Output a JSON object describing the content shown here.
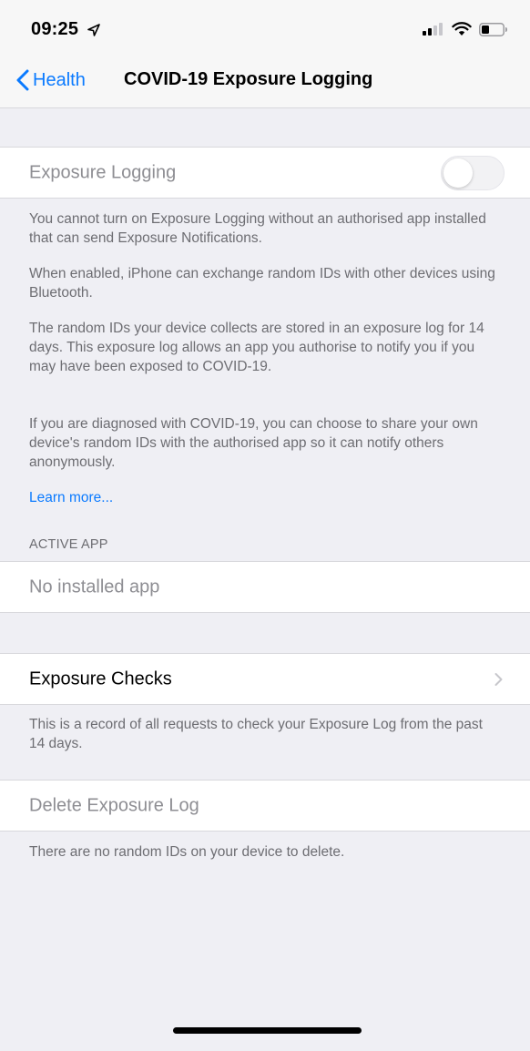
{
  "status_bar": {
    "time": "09:25",
    "icons": [
      "location-arrow-icon",
      "signal-icon",
      "wifi-icon",
      "battery-icon"
    ]
  },
  "nav": {
    "back_label": "Health",
    "title": "COVID-19 Exposure Logging"
  },
  "exposure_logging": {
    "label": "Exposure Logging",
    "toggle_on": false,
    "paragraphs": [
      "You cannot turn on Exposure Logging without an authorised app installed that can send Exposure Notifications.",
      "When enabled, iPhone can exchange random IDs with other devices using Bluetooth.",
      "The random IDs your device collects are stored in an exposure log for 14 days. This exposure log allows an app you authorise to notify you if you may have been exposed to COVID-19.",
      "If you are diagnosed with COVID-19, you can choose to share your own device's random IDs with the authorised app so it can notify others anonymously."
    ],
    "learn_more": "Learn more..."
  },
  "active_app": {
    "header": "ACTIVE APP",
    "value": "No installed app"
  },
  "exposure_checks": {
    "label": "Exposure Checks",
    "footer": "This is a record of all requests to check your Exposure Log from the past 14 days."
  },
  "delete_log": {
    "label": "Delete Exposure Log",
    "footer": "There are no random IDs on your device to delete."
  },
  "colors": {
    "accent": "#0a7aff",
    "background": "#efeff4",
    "secondary_text": "#6d6d72",
    "disabled_text": "#8e8e93"
  }
}
